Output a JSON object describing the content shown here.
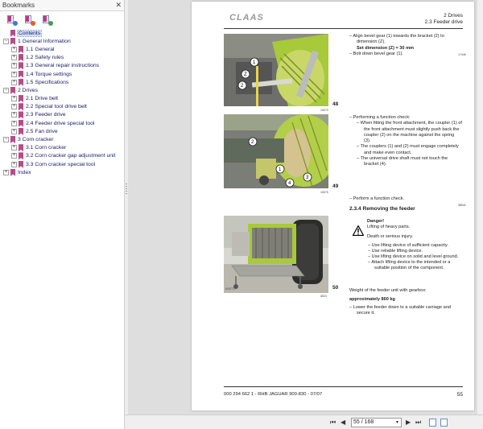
{
  "bookmarks_panel": {
    "title": "Bookmarks",
    "close_glyph": "✕",
    "toolbar_icons": [
      "expand-bookmark-icon",
      "delete-bookmark-icon",
      "find-bookmark-icon"
    ],
    "items": [
      {
        "label": "Contents",
        "level": 0,
        "expander": "",
        "selected": true
      },
      {
        "label": "1 General Information",
        "level": 0,
        "expander": "−"
      },
      {
        "label": "1.1 General",
        "level": 1,
        "expander": "+"
      },
      {
        "label": "1.2 Safety rules",
        "level": 1,
        "expander": "+"
      },
      {
        "label": "1.3 General repair instructions",
        "level": 1,
        "expander": "+"
      },
      {
        "label": "1.4 Torque settings",
        "level": 1,
        "expander": "+"
      },
      {
        "label": "1.5 Specifications",
        "level": 1,
        "expander": "+"
      },
      {
        "label": "2 Drives",
        "level": 0,
        "expander": "−"
      },
      {
        "label": "2.1 Drive belt",
        "level": 1,
        "expander": "+"
      },
      {
        "label": "2.2 Special tool drive belt",
        "level": 1,
        "expander": "+"
      },
      {
        "label": "2.3 Feeder drive",
        "level": 1,
        "expander": "+"
      },
      {
        "label": "2.4 Feeder drive special tool",
        "level": 1,
        "expander": "+"
      },
      {
        "label": "2.5 Fan drive",
        "level": 1,
        "expander": "+"
      },
      {
        "label": "3 Corn cracker",
        "level": 0,
        "expander": "−"
      },
      {
        "label": "3.1 Corn cracker",
        "level": 1,
        "expander": "+"
      },
      {
        "label": "3.2 Corn cracker gap adjustment unit",
        "level": 1,
        "expander": "+"
      },
      {
        "label": "3.3 Corn cracker special tool",
        "level": 1,
        "expander": "+"
      },
      {
        "label": "Index",
        "level": 0,
        "expander": "+"
      }
    ]
  },
  "page": {
    "logo": "CLAAS",
    "header_chapter": "2 Drives",
    "header_section": "2.3 Feeder drive",
    "figures": [
      {
        "number": "48",
        "code": "15079"
      },
      {
        "number": "49",
        "code": "15075"
      },
      {
        "number": "50",
        "code": "6524",
        "tag": "615771"
      }
    ],
    "ref_codes": {
      "top": "17446",
      "mid": "38542"
    },
    "block1": {
      "line1": "Align bevel gear (1) towards the bracket (2) to dimension (Z).",
      "line2": "Set dimension (Z) = 30 mm",
      "line3": "Bolt down bevel gear (1)."
    },
    "block2": {
      "intro": "Performing a function check:",
      "step1": "When fitting the front attachment, the coupler (1) of the front attachment must slightly push back the coupler (2) on the machine against the spring (3).",
      "step2": "The couplers (1) and (2) must engage completely and make even contact.",
      "step3": "The universal drive shaft must not touch the bracket (4)."
    },
    "block3": {
      "check": "Perform a function check.",
      "section_title": "2.3.4 Removing the feeder"
    },
    "danger": {
      "title": "Danger!",
      "line1": "Lifting of heavy parts.",
      "line2": "Death or serious injury.",
      "items": [
        "Use lifting device of sufficient capacity.",
        "Use reliable lifting device.",
        "Use lifting device on solid and level ground.",
        "Attach lifting device to the intended or a suitable position of the component."
      ]
    },
    "block4": {
      "weight_label": "Weight of the feeder unit with gearbox:",
      "weight_value": "approximately 860 kg",
      "instruction": "Lower the feeder down to a suitable carriage and secure it."
    },
    "footer_left": "000 294 662 1 - RHB JAGUAR 900-830 - 07/07",
    "footer_right": "55"
  },
  "navbar": {
    "first": "⏮",
    "prev": "◀",
    "next": "▶",
    "last": "⏭",
    "page_display": "55 / 168",
    "current_page": 55,
    "total_pages": 168
  },
  "colors": {
    "bookmark_icon": "#b94a8a",
    "selection": "#cfe0f7",
    "bookmark_text": "#1a1a66",
    "machine_green": "#a8c93a"
  }
}
